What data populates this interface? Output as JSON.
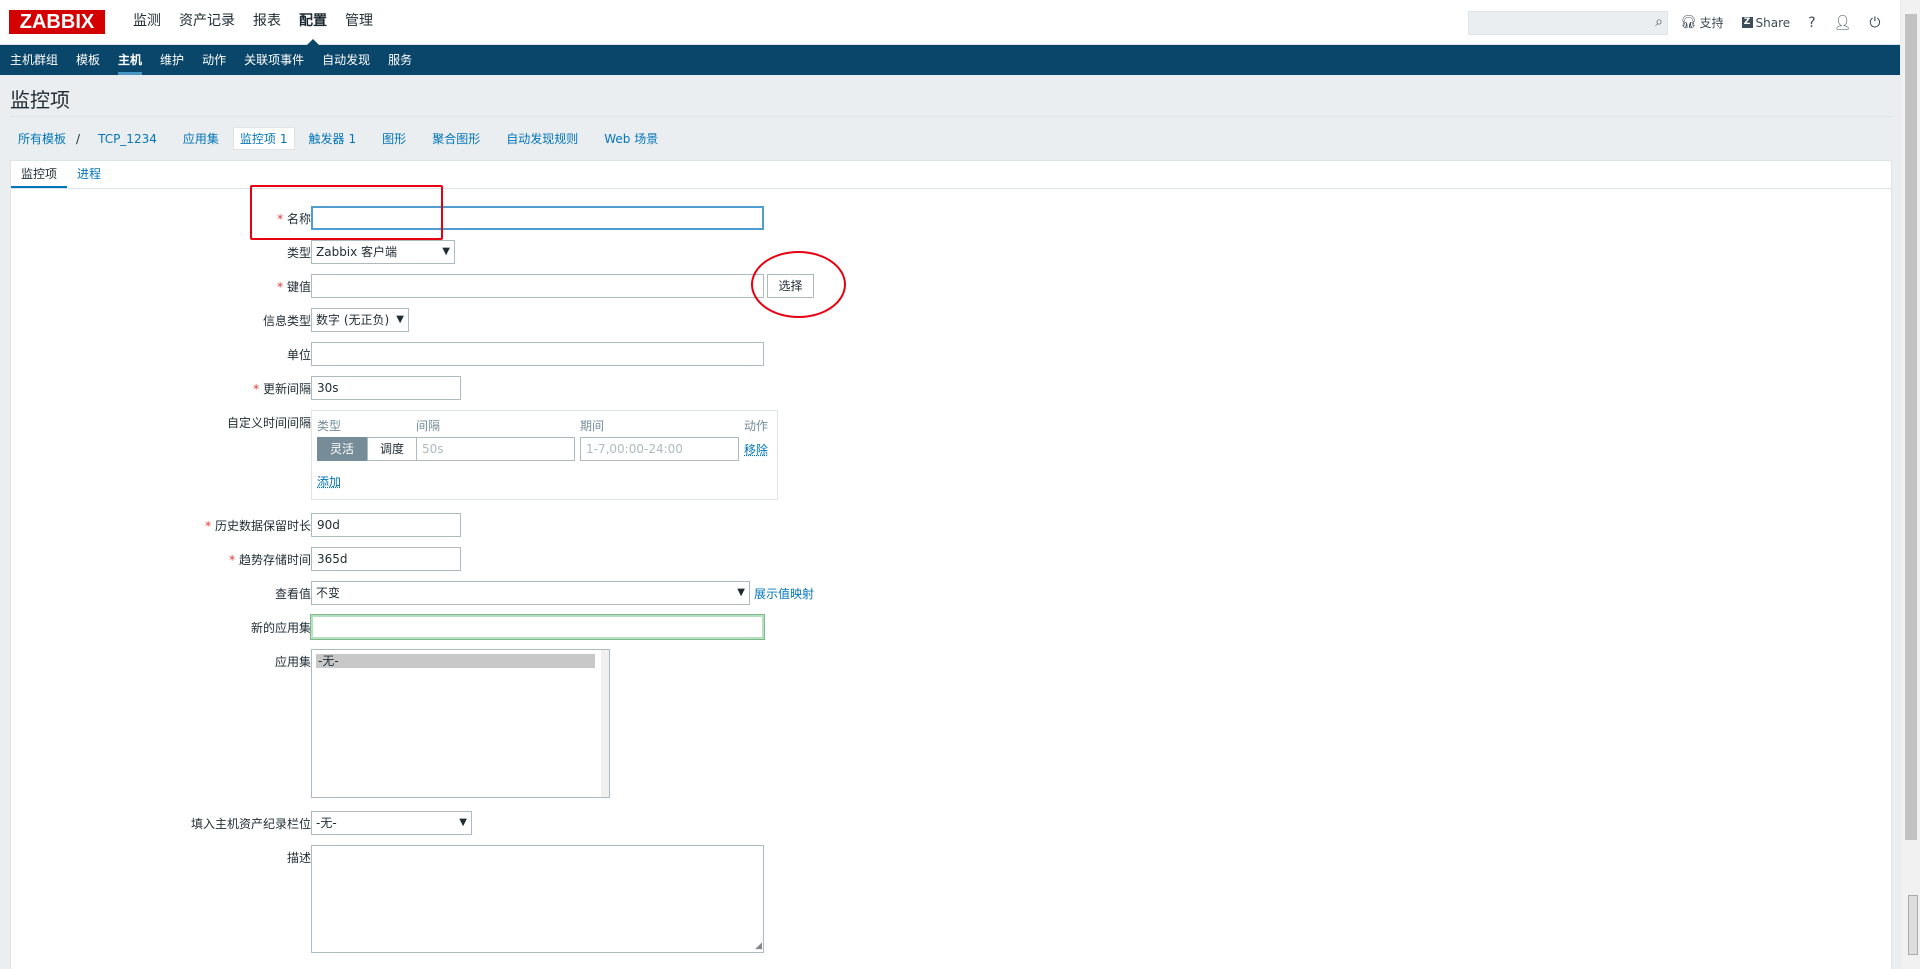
{
  "logo": "ZABBIX",
  "main_menu": [
    "监测",
    "资产记录",
    "报表",
    "配置",
    "管理"
  ],
  "main_menu_active": "配置",
  "search": {
    "placeholder": "",
    "icon": "search-icon"
  },
  "top_links": {
    "support": "支持",
    "share": "Share",
    "help": "?",
    "user": "user-icon",
    "logout": "power-icon"
  },
  "sub_menu": [
    "主机群组",
    "模板",
    "主机",
    "维护",
    "动作",
    "关联项事件",
    "自动发现",
    "服务"
  ],
  "sub_menu_active": "主机",
  "page_title": "监控项",
  "breadcrumb": {
    "all_templates": "所有模板",
    "template": "TCP_1234",
    "applications": "应用集",
    "items": "监控项",
    "items_count": "1",
    "triggers": "触发器",
    "triggers_count": "1",
    "graphs": "图形",
    "screens": "聚合图形",
    "discovery": "自动发现规则",
    "web": "Web 场景"
  },
  "tabs": [
    "监控项",
    "进程"
  ],
  "form": {
    "name_label": "名称",
    "name_value": "",
    "type_label": "类型",
    "type_value": "Zabbix 客户端",
    "key_label": "键值",
    "key_value": "",
    "key_select": "选择",
    "info_type_label": "信息类型",
    "info_type_value": "数字 (无正负)",
    "units_label": "单位",
    "units_value": "",
    "interval_label": "更新间隔",
    "interval_value": "30s",
    "custom_label": "自定义时间间隔",
    "custom_headers": {
      "type": "类型",
      "interval": "间隔",
      "period": "期间",
      "action": "动作"
    },
    "custom_flex": "灵活",
    "custom_sched": "调度",
    "custom_interval_placeholder": "50s",
    "custom_period_placeholder": "1-7,00:00-24:00",
    "custom_remove": "移除",
    "custom_add": "添加",
    "history_label": "历史数据保留时长",
    "history_value": "90d",
    "trends_label": "趋势存储时间",
    "trends_value": "365d",
    "valuemap_label": "查看值",
    "valuemap_value": "不变",
    "valuemap_link": "展示值映射",
    "new_app_label": "新的应用集",
    "new_app_value": "",
    "apps_label": "应用集",
    "apps_option": "-无-",
    "inventory_label": "填入主机资产纪录栏位",
    "inventory_value": "-无-",
    "desc_label": "描述"
  }
}
